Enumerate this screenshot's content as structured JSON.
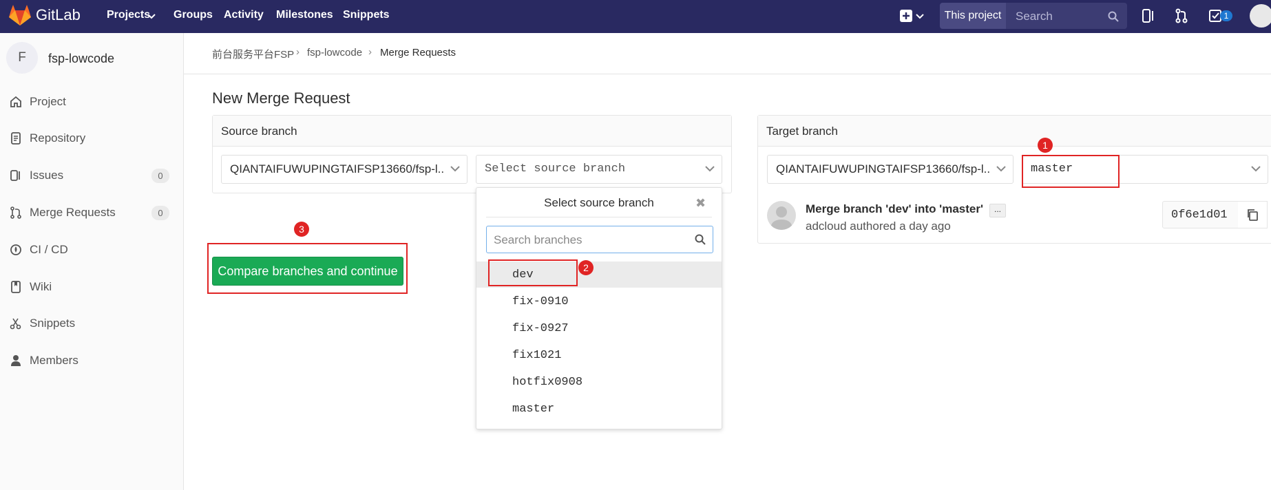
{
  "topnav": {
    "logo_text": "GitLab",
    "links": [
      "Projects",
      "Groups",
      "Activity",
      "Milestones",
      "Snippets"
    ],
    "scope_label": "This project",
    "search_placeholder": "Search",
    "todo_count": "1"
  },
  "sidebar": {
    "avatar_letter": "F",
    "project_name": "fsp-lowcode",
    "items": [
      {
        "label": "Project",
        "icon": "home-icon"
      },
      {
        "label": "Repository",
        "icon": "doc-icon"
      },
      {
        "label": "Issues",
        "icon": "issues-icon",
        "count": "0"
      },
      {
        "label": "Merge Requests",
        "icon": "merge-icon",
        "count": "0"
      },
      {
        "label": "CI / CD",
        "icon": "rocket-icon"
      },
      {
        "label": "Wiki",
        "icon": "book-icon"
      },
      {
        "label": "Snippets",
        "icon": "scissors-icon"
      },
      {
        "label": "Members",
        "icon": "user-icon"
      }
    ]
  },
  "breadcrumb": [
    "前台服务平台FSP",
    "fsp-lowcode",
    "Merge Requests"
  ],
  "page_title": "New Merge Request",
  "source": {
    "heading": "Source branch",
    "project": "QIANTAIFUWUPINGTAIFSP13660/fsp-l...",
    "branch_placeholder": "Select source branch"
  },
  "branch_menu": {
    "title": "Select source branch",
    "search_placeholder": "Search branches",
    "branches": [
      "dev",
      "fix-0910",
      "fix-0927",
      "fix1021",
      "hotfix0908",
      "master"
    ],
    "active_branch": "dev"
  },
  "target": {
    "heading": "Target branch",
    "project": "QIANTAIFUWUPINGTAIFSP13660/fsp-l...",
    "branch": "master"
  },
  "commit": {
    "title": "Merge branch 'dev' into 'master'",
    "ellipsis": "...",
    "meta": "adcloud authored a day ago",
    "sha": "0f6e1d01"
  },
  "compare_button": "Compare branches and continue",
  "annotations": [
    "1",
    "2",
    "3"
  ],
  "colors": {
    "nav_bg": "#292961",
    "primary_green": "#1aaa55",
    "annotation_red": "#e02424",
    "focus_blue": "#73afea"
  }
}
